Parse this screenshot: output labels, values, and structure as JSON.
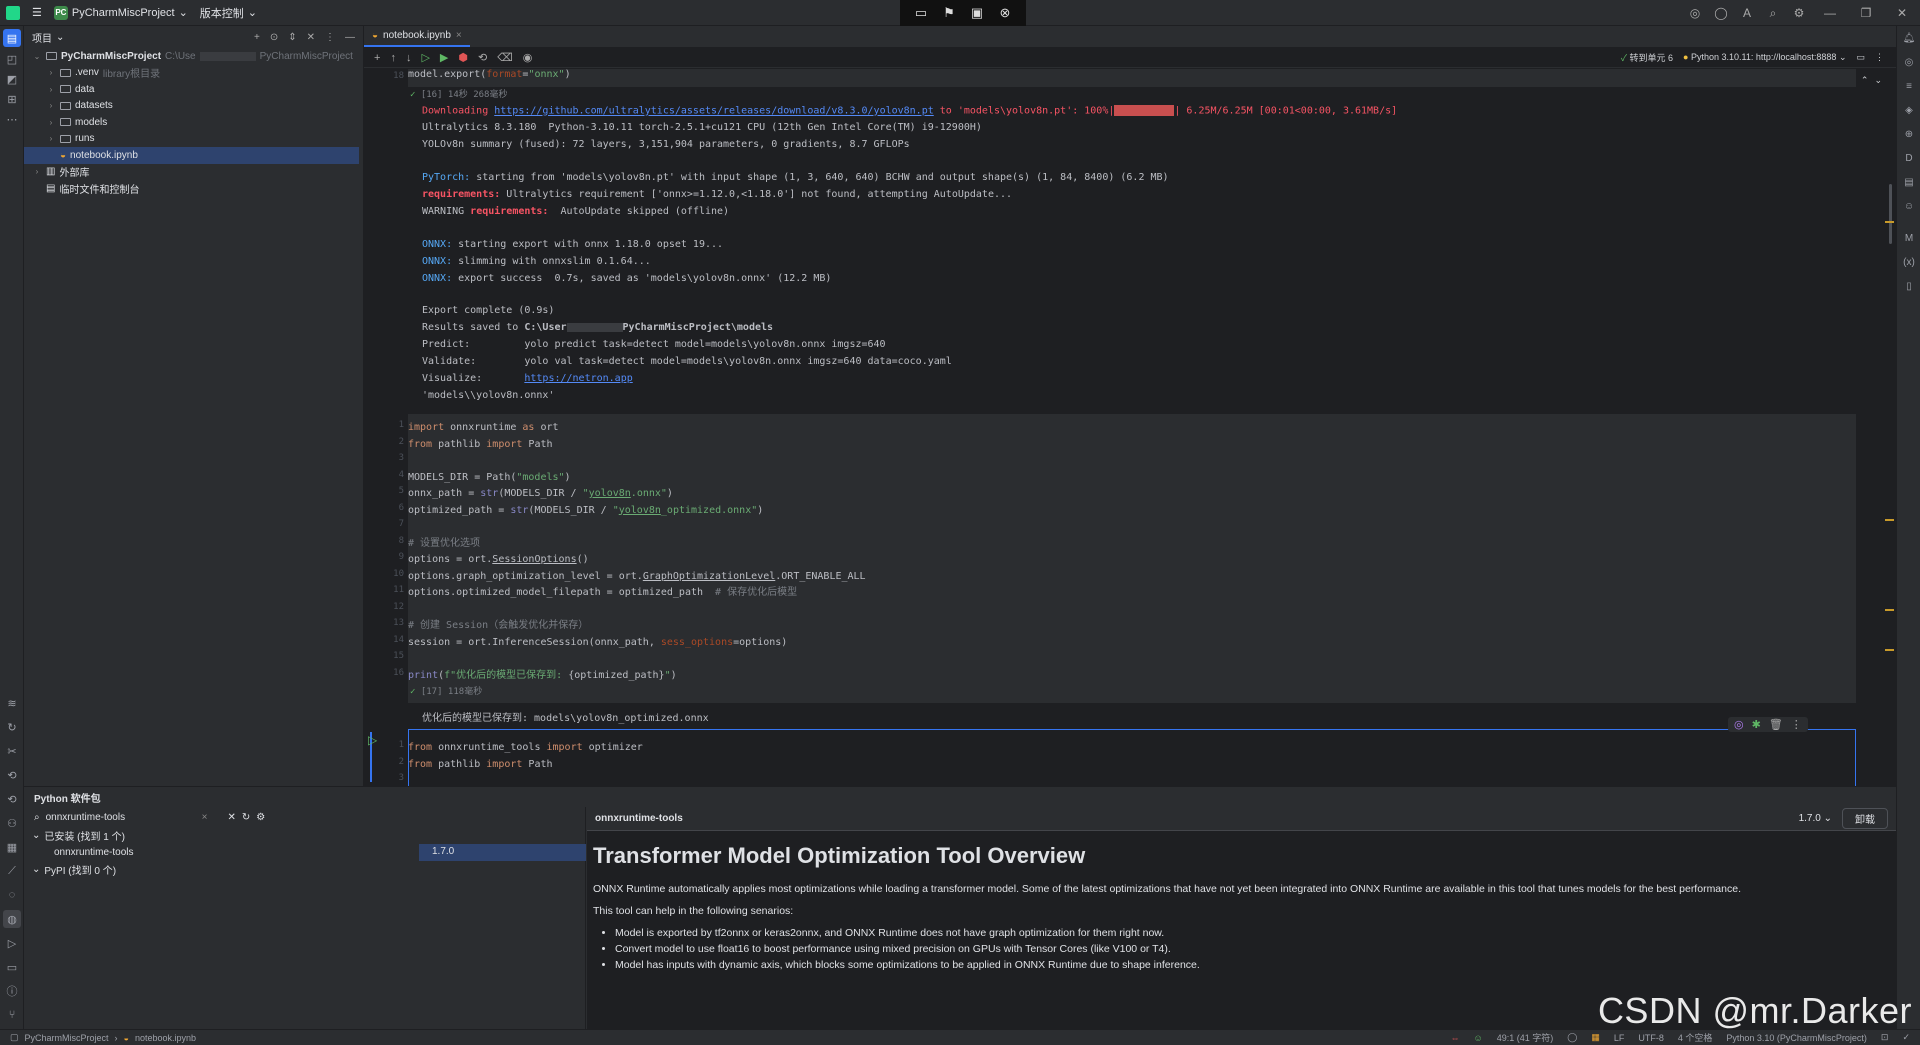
{
  "titlebar": {
    "project_badge": "PC",
    "project_name": "PyCharmMiscProject",
    "vcs_label": "版本控制"
  },
  "project_panel": {
    "header": "项目",
    "root_name": "PyCharmMiscProject",
    "root_path_prefix": "C:\\Use",
    "root_path_suffix": "PyCharmMiscProject",
    "venv": ".venv",
    "venv_note": "library根目录",
    "folders": [
      "data",
      "datasets",
      "models",
      "runs"
    ],
    "selected_file": "notebook.ipynb",
    "external_libs": "外部库",
    "scratches": "临时文件和控制台"
  },
  "editor": {
    "tab_label": "notebook.ipynb",
    "toolbar_goto": "转到单元 6",
    "kernel": "Python 3.10.11: http://localhost:8888",
    "inspections": {
      "warn1": "5",
      "warn2": "18",
      "ok": "15"
    }
  },
  "cell_prev": {
    "line_no": "18",
    "code": "model.export(format=\"onnx\")",
    "exec": "[16] 14秒 268毫秒",
    "out_download_pre": "Downloading ",
    "out_download_url": "https://github.com/ultralytics/assets/releases/download/v8.3.0/yolov8n.pt",
    "out_download_post": " to 'models\\yolov8n.pt': 100%|",
    "out_download_tail": "| 6.25M/6.25M [00:01<00:00, 3.61MB/s]",
    "out_lines": [
      "Ultralytics 8.3.180  Python-3.10.11 torch-2.5.1+cu121 CPU (12th Gen Intel Core(TM) i9-12900H)",
      "YOLOv8n summary (fused): 72 layers, 3,151,904 parameters, 0 gradients, 8.7 GFLOPs"
    ],
    "pytorch_label": "PyTorch:",
    "pytorch_text": " starting from 'models\\yolov8n.pt' with input shape (1, 3, 640, 640) BCHW and output shape(s) (1, 84, 8400) (6.2 MB)",
    "req_label": "requirements:",
    "req_text": " Ultralytics requirement ['onnx>=1.12.0,<1.18.0'] not found, attempting AutoUpdate...",
    "warn_pre": "WARNING ",
    "warn_text": "  AutoUpdate skipped (offline)",
    "onnx_label": "ONNX:",
    "onnx_lines": [
      " starting export with onnx 1.18.0 opset 19...",
      " slimming with onnxslim 0.1.64...",
      " export success  0.7s, saved as 'models\\yolov8n.onnx' (12.2 MB)"
    ],
    "export_complete": "Export complete (0.9s)",
    "results_pre": "Results saved to ",
    "results_path_pre": "C:\\User",
    "results_path_post": "PyCharmMiscProject\\models",
    "predict": "Predict:         yolo predict task=detect model=models\\yolov8n.onnx imgsz=640",
    "validate": "Validate:        yolo val task=detect model=models\\yolov8n.onnx imgsz=640 data=coco.yaml",
    "visualize_pre": "Visualize:       ",
    "visualize_url": "https://netron.app",
    "return_val": "'models\\\\yolov8n.onnx'"
  },
  "cell17": {
    "line_numbers": [
      "1",
      "2",
      "3",
      "4",
      "5",
      "6",
      "7",
      "8",
      "9",
      "10",
      "11",
      "12",
      "13",
      "14",
      "15",
      "16"
    ],
    "exec": "[17] 118毫秒",
    "output": "优化后的模型已保存到: models\\yolov8n_optimized.onnx"
  },
  "cell18": {
    "line_numbers": [
      "1",
      "2",
      "3"
    ],
    "code_line1": "from onnxruntime_tools import optimizer",
    "code_line2": "from pathlib import Path"
  },
  "packages": {
    "panel_title": "Python 软件包",
    "search_value": "onnxruntime-tools",
    "installed_group": "已安装 (找到 1 个)",
    "installed_name": "onnxruntime-tools",
    "installed_version": "1.7.0",
    "pypi_group": "PyPI (找到 0 个)",
    "detail_name": "onnxruntime-tools",
    "detail_version": "1.7.0",
    "uninstall": "卸载",
    "doc_title": "Transformer Model Optimization Tool Overview",
    "doc_p1": "ONNX Runtime automatically applies most optimizations while loading a transformer model. Some of the latest optimizations that have not yet been integrated into ONNX Runtime are available in this tool that tunes models for the best performance.",
    "doc_p2": "This tool can help in the following senarios:",
    "doc_items": [
      "Model is exported by tf2onnx or keras2onnx, and ONNX Runtime does not have graph optimization for them right now.",
      "Convert model to use float16 to boost performance using mixed precision on GPUs with Tensor Cores (like V100 or T4).",
      "Model has inputs with dynamic axis, which blocks some optimizations to be applied in ONNX Runtime due to shape inference."
    ]
  },
  "statusbar": {
    "crumb1": "PyCharmMiscProject",
    "crumb2": "notebook.ipynb",
    "position": "49:1 (41 字符)",
    "line_sep": "LF",
    "encoding": "UTF-8",
    "indent": "4 个空格",
    "interpreter": "Python 3.10 (PyCharmMiscProject)"
  },
  "watermark": "CSDN @mr.Darker",
  "colors": {
    "accent": "#3574f0",
    "selection": "#2e436e",
    "error": "#f75464",
    "link": "#548af7"
  }
}
